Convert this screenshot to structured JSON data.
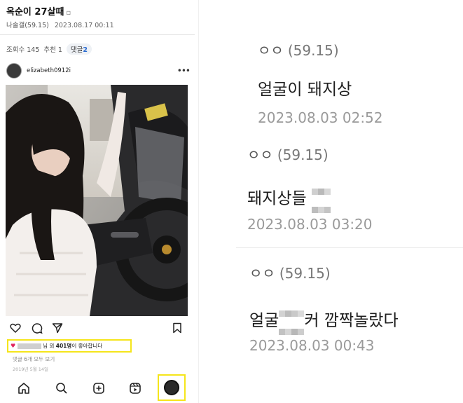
{
  "left_panel": {
    "post_title": "옥순이 27살때",
    "title_icon": "image-attached-icon",
    "author": "나솔갤(59.15)",
    "datetime": "2023.08.17 00:11",
    "views": "조회수 145",
    "recommend": "추천 1",
    "comments_label": "댓글",
    "comments_count": "2",
    "instagram": {
      "username": "elizabeth0912i",
      "more_icon": "more-dots-icon",
      "action_icons": [
        "heart-icon",
        "comment-icon",
        "share-icon",
        "bookmark-icon"
      ],
      "likes_suffix": "님 외",
      "likes_count": "401명",
      "likes_tail": "이 좋아합니다",
      "view_comments": "댓글 6개 모두 보기",
      "post_date": "2019년 5월 14일",
      "nav_icons": [
        "home-icon",
        "search-icon",
        "add-post-icon",
        "reels-icon",
        "profile-avatar-icon"
      ]
    }
  },
  "comments": [
    {
      "author": "ㅇㅇ",
      "score": "(59.15)",
      "text": "얼굴이 돼지상",
      "date": "2023.08.03 02:52"
    },
    {
      "author": "ㅇㅇ",
      "score": "(59.15)",
      "text_before": "돼지상들",
      "text_after": "",
      "date": "2023.08.03 03:20"
    },
    {
      "author": "ㅇㅇ",
      "score": "(59.15)",
      "text_before": "얼굴",
      "text_after": "커 깜짝놀랐다",
      "date": "2023.08.03 00:43"
    }
  ],
  "colors": {
    "highlight": "#f5e51b",
    "heart": "#e0245e",
    "badge_number": "#2a6bd1"
  }
}
